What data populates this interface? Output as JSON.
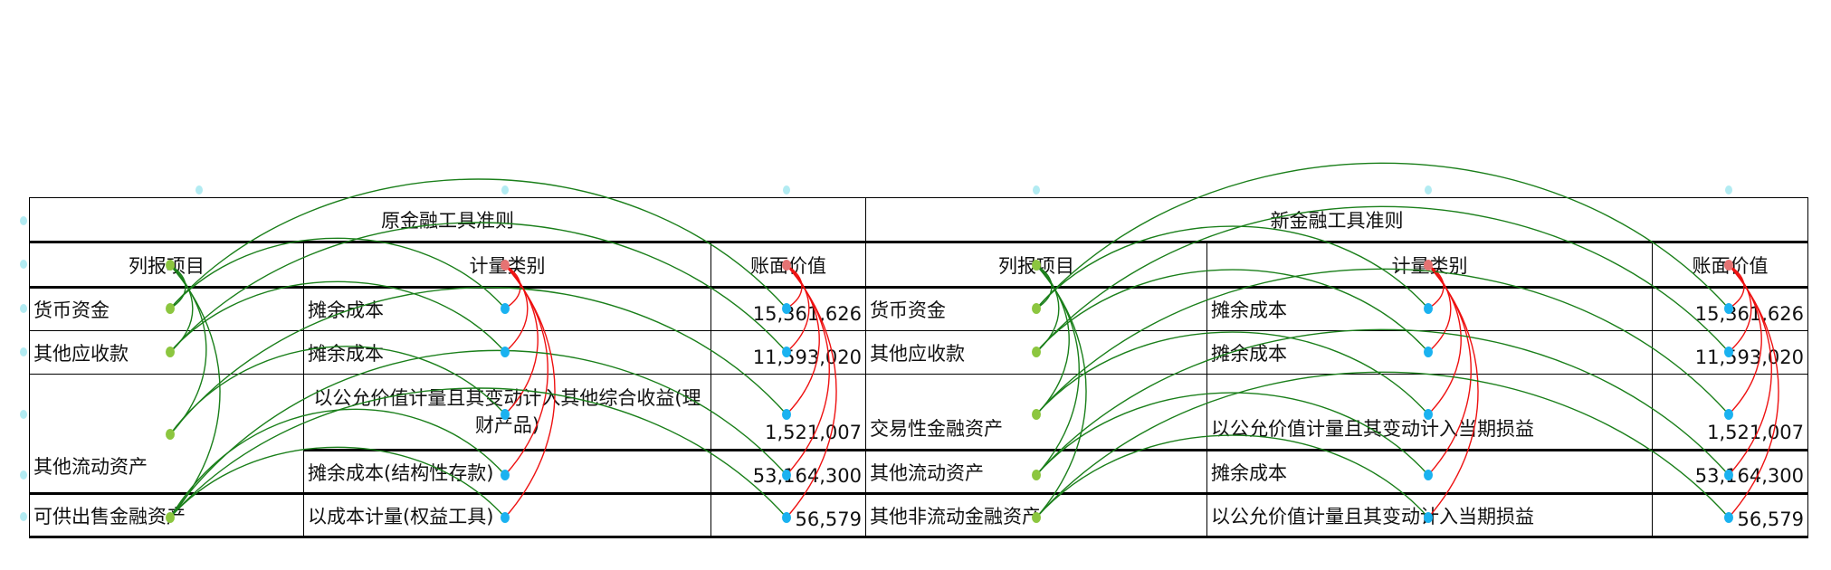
{
  "old_standard": {
    "title": "原金融工具准则",
    "headers": [
      "列报项目",
      "计量类别",
      "账面价值"
    ],
    "rows": [
      {
        "item": "货币资金",
        "category": "摊余成本",
        "value": "15,361,626"
      },
      {
        "item": "其他应收款",
        "category": "摊余成本",
        "value": "11,593,020"
      },
      {
        "item": "其他流动资产",
        "category": "以公允价值计量且其变动计入其他综合收益(理财产品)",
        "value": "1,521,007"
      },
      {
        "item": "",
        "category": "摊余成本(结构性存款)",
        "value": "53,164,300"
      },
      {
        "item": "可供出售金融资产",
        "category": "以成本计量(权益工具)",
        "value": "56,579"
      }
    ]
  },
  "new_standard": {
    "title": "新金融工具准则",
    "headers": [
      "列报项目",
      "计量类别",
      "账面价值"
    ],
    "rows": [
      {
        "item": "货币资金",
        "category": "摊余成本",
        "value": "15,361,626"
      },
      {
        "item": "其他应收款",
        "category": "摊余成本",
        "value": "11,593,020"
      },
      {
        "item": "交易性金融资产",
        "category": "以公允价值计量且其变动计入当期损益",
        "value": "1,521,007"
      },
      {
        "item": "其他流动资产",
        "category": "摊余成本",
        "value": "53,164,300"
      },
      {
        "item": "其他非流动金融资产",
        "category": "以公允价值计量且其变动计入当期损益",
        "value": "56,579"
      }
    ]
  },
  "overlay_colors": {
    "item_dot": "#8cc63f",
    "cell_dot": "#1ab2f0",
    "header_dot": "#e57373",
    "grid_dot": "#b2ebf2",
    "green_arc": "#1a7f1a",
    "red_arc": "#ee1111"
  }
}
